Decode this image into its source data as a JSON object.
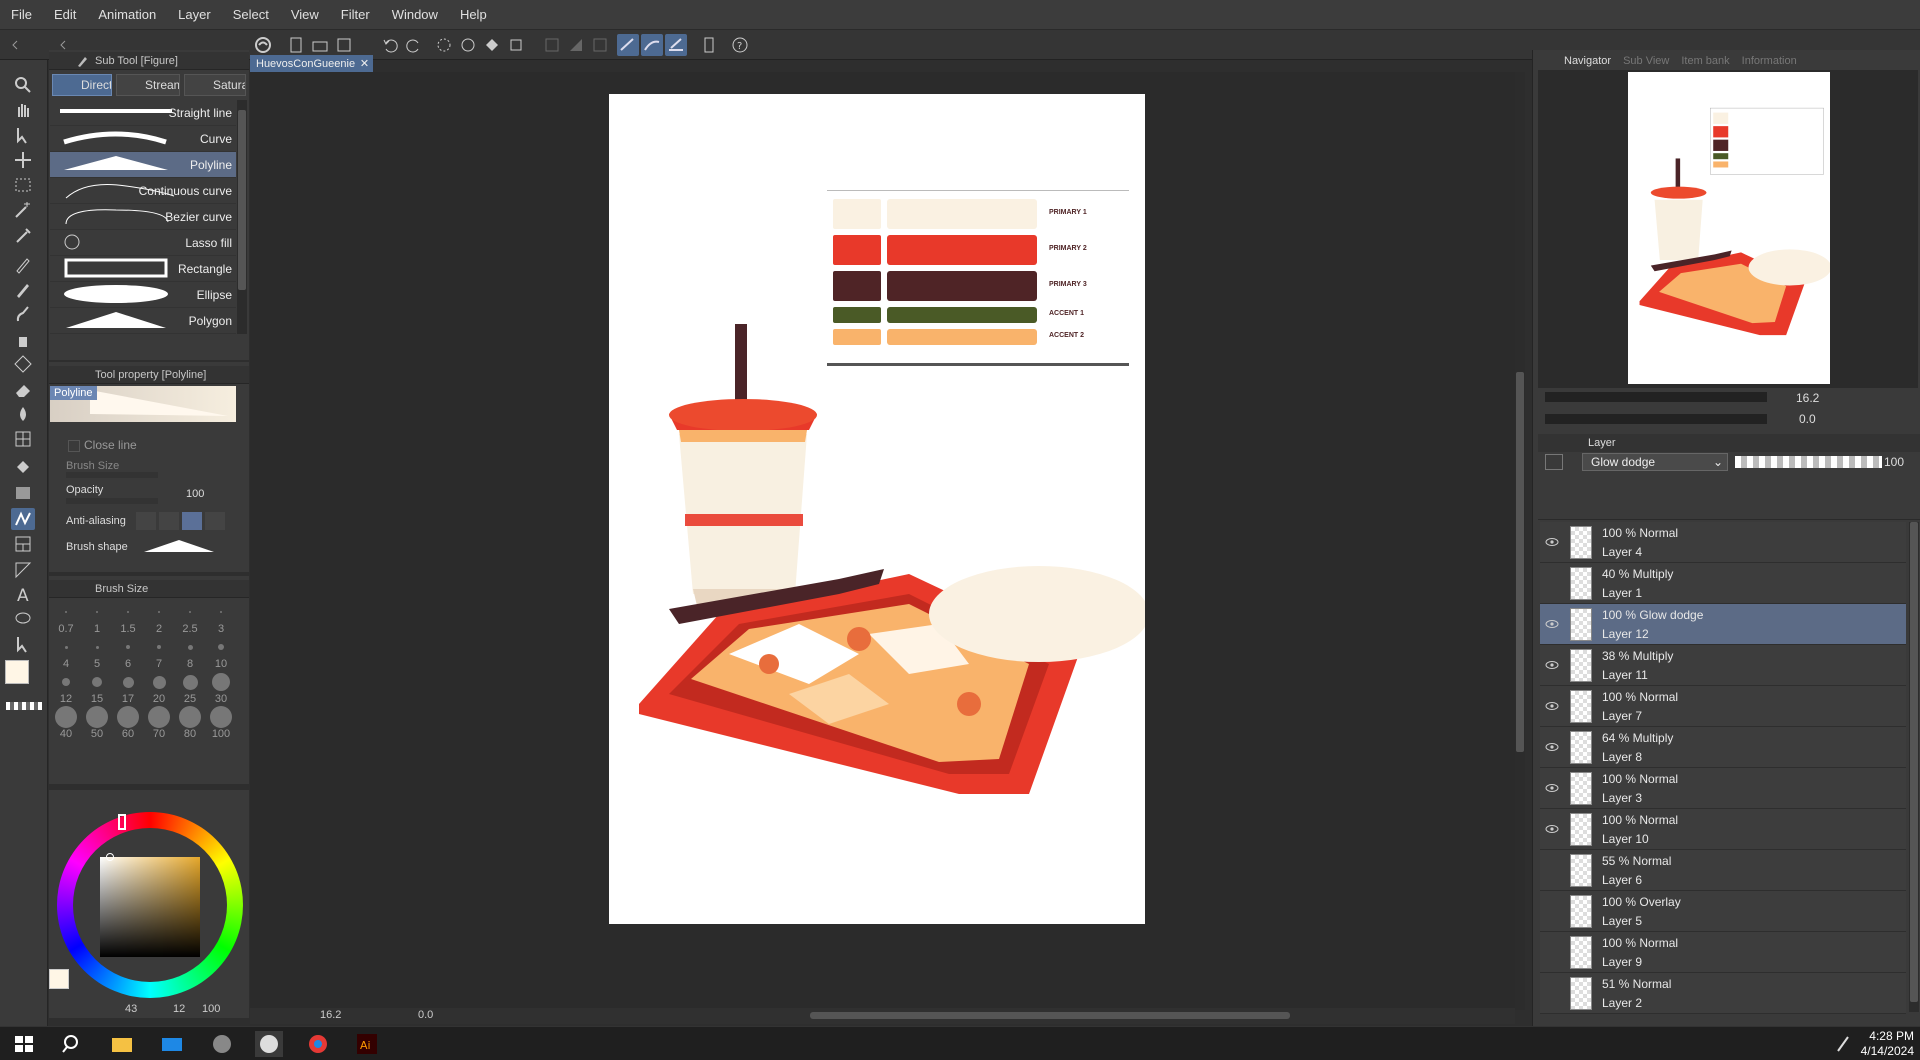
{
  "menu": [
    "File",
    "Edit",
    "Animation",
    "Layer",
    "Select",
    "View",
    "Filter",
    "Window",
    "Help"
  ],
  "document": {
    "tab_title": "HuevosConGueenie"
  },
  "subtool": {
    "panel_title": "Sub Tool [Figure]",
    "tabs": [
      "Direct",
      "Stream",
      "Saturat"
    ],
    "items": [
      "Straight line",
      "Curve",
      "Polyline",
      "Continuous curve",
      "Bezier curve",
      "Lasso fill",
      "Rectangle",
      "Ellipse",
      "Polygon"
    ],
    "selected": "Polyline"
  },
  "tool_property": {
    "panel_title": "Tool property [Polyline]",
    "preset_name": "Polyline",
    "close_line": "Close line",
    "brush_size_label": "Brush Size",
    "opacity_label": "Opacity",
    "opacity_value": "100",
    "antialiasing_label": "Anti-aliasing",
    "brush_shape_label": "Brush shape"
  },
  "brush_size": {
    "panel_title": "Brush Size",
    "sizes": [
      "0.7",
      "1",
      "1.5",
      "2",
      "2.5",
      "3",
      "4",
      "5",
      "6",
      "7",
      "8",
      "10",
      "12",
      "15",
      "17",
      "20",
      "25",
      "30",
      "40",
      "50",
      "60",
      "70",
      "80",
      "100"
    ]
  },
  "color": {
    "hsv_readout": [
      "43",
      "12",
      "100"
    ],
    "main_color": "#fff6e6",
    "sub_color": "#5e3a6e"
  },
  "navigator": {
    "tabs": [
      "Navigator",
      "Sub View",
      "Item bank",
      "Information"
    ],
    "zoom": "16.2",
    "rotation": "0.0"
  },
  "layer_panel": {
    "title": "Layer",
    "blend_mode": "Glow dodge",
    "opacity": "100",
    "layers": [
      {
        "mode": "100 % Normal",
        "name": "Layer 4",
        "visible": true
      },
      {
        "mode": "40 % Multiply",
        "name": "Layer 1",
        "visible": false
      },
      {
        "mode": "100 % Glow dodge",
        "name": "Layer 12",
        "visible": true,
        "selected": true
      },
      {
        "mode": "38 % Multiply",
        "name": "Layer 11",
        "visible": true
      },
      {
        "mode": "100 % Normal",
        "name": "Layer 7",
        "visible": true
      },
      {
        "mode": "64 % Multiply",
        "name": "Layer 8",
        "visible": true
      },
      {
        "mode": "100 % Normal",
        "name": "Layer 3",
        "visible": true
      },
      {
        "mode": "100 % Normal",
        "name": "Layer 10",
        "visible": true
      },
      {
        "mode": "55 % Normal",
        "name": "Layer 6",
        "visible": false
      },
      {
        "mode": "100 % Overlay",
        "name": "Layer 5",
        "visible": false
      },
      {
        "mode": "100 % Normal",
        "name": "Layer 9",
        "visible": false
      },
      {
        "mode": "51 % Normal",
        "name": "Layer 2",
        "visible": false
      }
    ]
  },
  "status": {
    "zoom": "16.2",
    "rotation": "0.0"
  },
  "palette_card": {
    "rows": [
      "PRIMARY 1",
      "PRIMARY 2",
      "PRIMARY 3",
      "ACCENT 1",
      "ACCENT 2"
    ],
    "colors": [
      "#faf1e2",
      "#e8392a",
      "#4f2426",
      "#4a5a26",
      "#f9b36b"
    ]
  },
  "taskbar": {
    "time": "4:28 PM",
    "date": "4/14/2024"
  }
}
